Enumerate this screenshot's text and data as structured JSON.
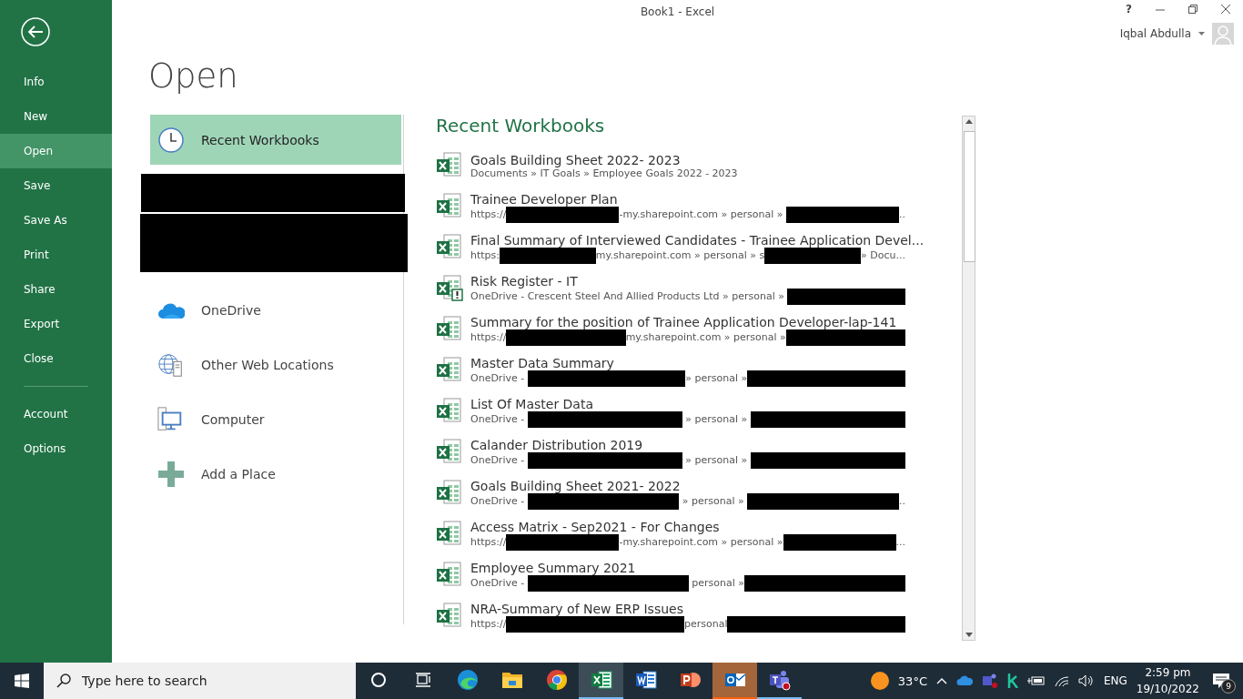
{
  "window": {
    "title": "Book1 - Excel",
    "help": "?",
    "user": "Iqbal Abdulla"
  },
  "nav": [
    {
      "label": "Info",
      "selected": false
    },
    {
      "label": "New",
      "selected": false
    },
    {
      "label": "Open",
      "selected": true
    },
    {
      "label": "Save",
      "selected": false
    },
    {
      "label": "Save As",
      "selected": false
    },
    {
      "label": "Print",
      "selected": false
    },
    {
      "label": "Share",
      "selected": false
    },
    {
      "label": "Export",
      "selected": false
    },
    {
      "label": "Close",
      "selected": false
    },
    {
      "label": "Account",
      "selected": false
    },
    {
      "label": "Options",
      "selected": false
    }
  ],
  "page_title": "Open",
  "places": [
    {
      "kind": "recent",
      "label": "Recent Workbooks",
      "selected": true
    },
    {
      "kind": "redacted"
    },
    {
      "kind": "redacted"
    },
    {
      "kind": "onedrive",
      "label": "OneDrive",
      "selected": false
    },
    {
      "kind": "web",
      "label": "Other Web Locations",
      "selected": false
    },
    {
      "kind": "computer",
      "label": "Computer",
      "selected": false
    },
    {
      "kind": "add",
      "label": "Add a Place",
      "selected": false
    }
  ],
  "recent": {
    "heading": "Recent Workbooks",
    "files": [
      {
        "name": "Goals Building Sheet 2022- 2023",
        "warning": false,
        "path": [
          {
            "kind": "text",
            "text": "Documents » IT Goals » Employee Goals 2022 - 2023"
          }
        ]
      },
      {
        "name": "Trainee Developer Plan",
        "warning": false,
        "path": [
          {
            "kind": "text",
            "text": "https://"
          },
          {
            "kind": "redacted"
          },
          {
            "kind": "text",
            "text": "-my.sharepoint.com » personal » "
          },
          {
            "kind": "redacted"
          },
          {
            "kind": "text",
            "text": ".."
          }
        ]
      },
      {
        "name": "Final Summary of Interviewed Candidates - Trainee Application Devel...",
        "warning": false,
        "path": [
          {
            "kind": "text",
            "text": "https:"
          },
          {
            "kind": "redacted"
          },
          {
            "kind": "text",
            "text": "my.sharepoint.com » personal » s"
          },
          {
            "kind": "redacted"
          },
          {
            "kind": "text",
            "text": "» Docu..."
          }
        ]
      },
      {
        "name": "Risk Register - IT",
        "warning": true,
        "path": [
          {
            "kind": "text",
            "text": "OneDrive - Crescent Steel And Allied Products Ltd » personal » "
          },
          {
            "kind": "redacted"
          }
        ]
      },
      {
        "name": "Summary for the position of Trainee Application Developer-lap-141",
        "warning": false,
        "path": [
          {
            "kind": "text",
            "text": "https://"
          },
          {
            "kind": "redacted"
          },
          {
            "kind": "text",
            "text": "my.sharepoint.com » personal »"
          },
          {
            "kind": "redacted"
          }
        ]
      },
      {
        "name": "Master Data Summary",
        "warning": false,
        "path": [
          {
            "kind": "text",
            "text": "OneDrive - "
          },
          {
            "kind": "redacted"
          },
          {
            "kind": "text",
            "text": "» personal »"
          },
          {
            "kind": "redacted"
          }
        ]
      },
      {
        "name": "List Of Master Data",
        "warning": false,
        "path": [
          {
            "kind": "text",
            "text": "OneDrive - "
          },
          {
            "kind": "redacted"
          },
          {
            "kind": "text",
            "text": " » personal » "
          },
          {
            "kind": "redacted"
          }
        ]
      },
      {
        "name": "Calander Distribution 2019",
        "warning": false,
        "path": [
          {
            "kind": "text",
            "text": "OneDrive - "
          },
          {
            "kind": "redacted"
          },
          {
            "kind": "text",
            "text": " » personal » "
          },
          {
            "kind": "redacted"
          }
        ]
      },
      {
        "name": "Goals Building Sheet 2021- 2022",
        "warning": false,
        "path": [
          {
            "kind": "text",
            "text": "OneDrive - "
          },
          {
            "kind": "redacted"
          },
          {
            "kind": "text",
            "text": " » personal » "
          },
          {
            "kind": "redacted"
          },
          {
            "kind": "text",
            "text": ".."
          }
        ]
      },
      {
        "name": "Access Matrix - Sep2021 - For Changes",
        "warning": false,
        "path": [
          {
            "kind": "text",
            "text": "https://"
          },
          {
            "kind": "redacted"
          },
          {
            "kind": "text",
            "text": "-my.sharepoint.com » personal »"
          },
          {
            "kind": "redacted"
          },
          {
            "kind": "text",
            "text": "..."
          }
        ]
      },
      {
        "name": "Employee Summary 2021",
        "warning": false,
        "path": [
          {
            "kind": "text",
            "text": "OneDrive - "
          },
          {
            "kind": "redacted"
          },
          {
            "kind": "text",
            "text": " personal »"
          },
          {
            "kind": "redacted"
          }
        ]
      },
      {
        "name": "NRA-Summary of New ERP Issues",
        "warning": false,
        "path": [
          {
            "kind": "text",
            "text": "https://"
          },
          {
            "kind": "redacted"
          },
          {
            "kind": "text",
            "text": "personal"
          },
          {
            "kind": "redacted"
          }
        ]
      }
    ]
  },
  "taskbar": {
    "search_placeholder": "Type here to search",
    "apps": [
      {
        "kind": "cortana",
        "active": false,
        "running": false,
        "flashing": false
      },
      {
        "kind": "taskview",
        "active": false,
        "running": false,
        "flashing": false
      },
      {
        "kind": "edge",
        "active": false,
        "running": false,
        "flashing": false
      },
      {
        "kind": "explorer",
        "active": false,
        "running": false,
        "flashing": false
      },
      {
        "kind": "chrome",
        "active": false,
        "running": false,
        "flashing": false
      },
      {
        "kind": "excel",
        "active": true,
        "running": true,
        "flashing": false
      },
      {
        "kind": "word",
        "active": false,
        "running": false,
        "flashing": false
      },
      {
        "kind": "powerpoint",
        "active": false,
        "running": false,
        "flashing": false
      },
      {
        "kind": "outlook",
        "active": false,
        "running": true,
        "flashing": true
      },
      {
        "kind": "teams",
        "active": false,
        "running": true,
        "flashing": false
      }
    ],
    "temperature": "33°C",
    "language": "ENG",
    "time": "2:59 pm",
    "date": "19/10/2022",
    "notifications": "9"
  }
}
